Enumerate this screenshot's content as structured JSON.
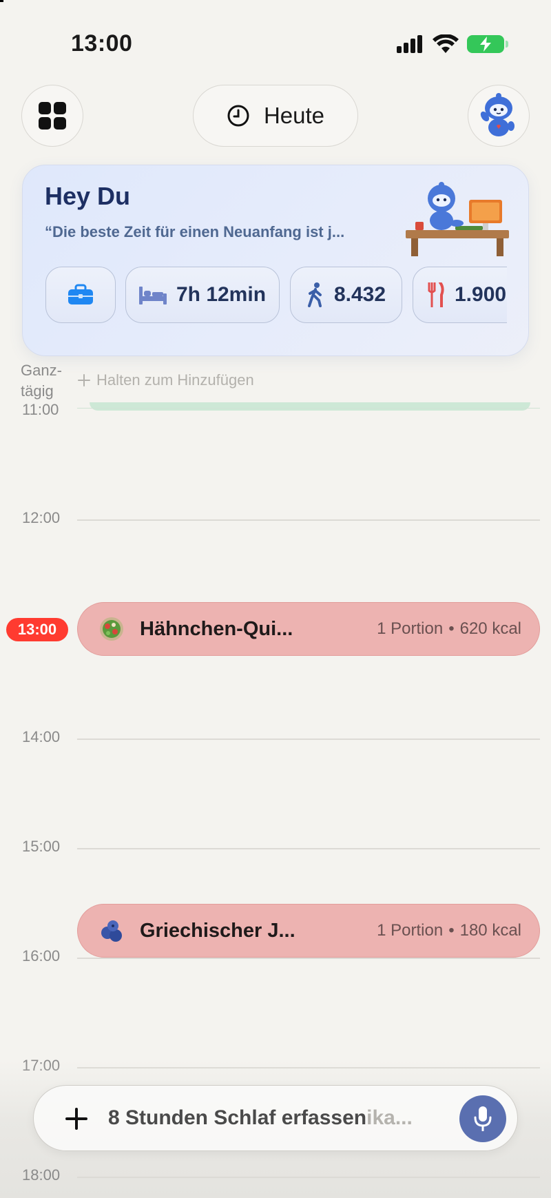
{
  "status_bar": {
    "time": "13:00"
  },
  "nav": {
    "today_label": "Heute"
  },
  "hero": {
    "title": "Hey Du",
    "quote": "“Die beste Zeit für einen Neuanfang ist j...",
    "chips": {
      "sleep": "7h 12min",
      "steps": "8.432",
      "food": "1.900"
    }
  },
  "allday": {
    "label": "Ganz-\ntägig",
    "add_hint": "Halten zum Hinzufügen"
  },
  "timeline": {
    "hours": [
      "11:00",
      "12:00",
      "14:00",
      "15:00",
      "16:00",
      "17:00",
      "18:00"
    ],
    "now": "13:00"
  },
  "events": [
    {
      "title": "Hähnchen-Qui...",
      "portion": "1 Portion",
      "kcal": "620 kcal"
    },
    {
      "title": "Griechischer J...",
      "portion": "1 Portion",
      "kcal": "180 kcal"
    }
  ],
  "input": {
    "placeholder": "8 Stunden Schlaf erfassen",
    "ghost": "ika..."
  },
  "colors": {
    "event_bg": "#edb3b1",
    "now_badge": "#ff3b30",
    "mic": "#5a6fb0",
    "hero_bg": "#dfe8fb"
  }
}
